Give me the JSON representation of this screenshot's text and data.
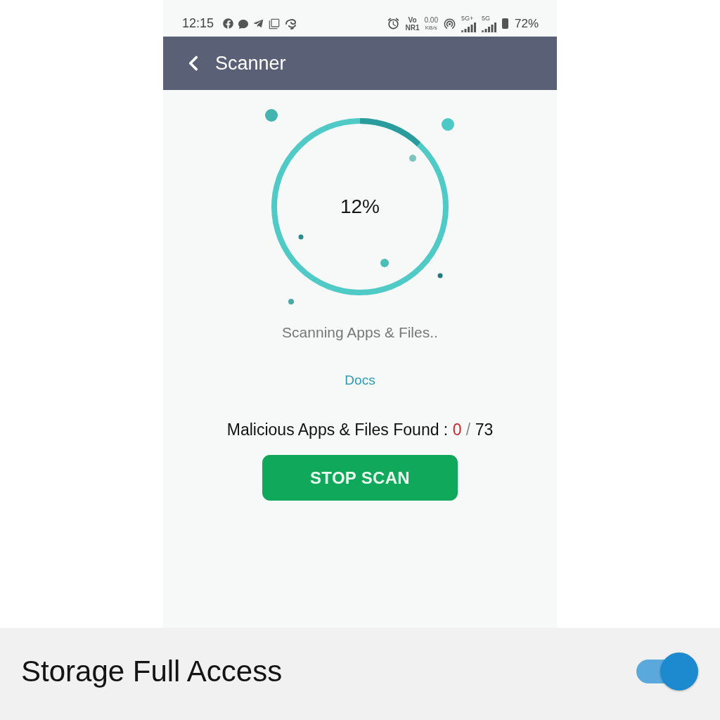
{
  "status_bar": {
    "time": "12:15",
    "network": [
      "Vo",
      "NR1"
    ],
    "data_rate": [
      "0.00",
      "KB/s"
    ],
    "signals": [
      {
        "label": "5G+"
      },
      {
        "label": "5G"
      }
    ],
    "battery": "72%"
  },
  "app_bar": {
    "title": "Scanner"
  },
  "scan_progress": {
    "level": 0.12,
    "reading": "12%"
  },
  "status_text": "Scanning Apps & Files..",
  "current_category": "Docs",
  "result": {
    "label": "Malicious Apps & Files Found :",
    "found": "0",
    "separator": "/",
    "total": "73"
  },
  "stop_button": {
    "label": "STOP SCAN"
  },
  "setting": {
    "label": "Storage Full Access",
    "on": true
  }
}
